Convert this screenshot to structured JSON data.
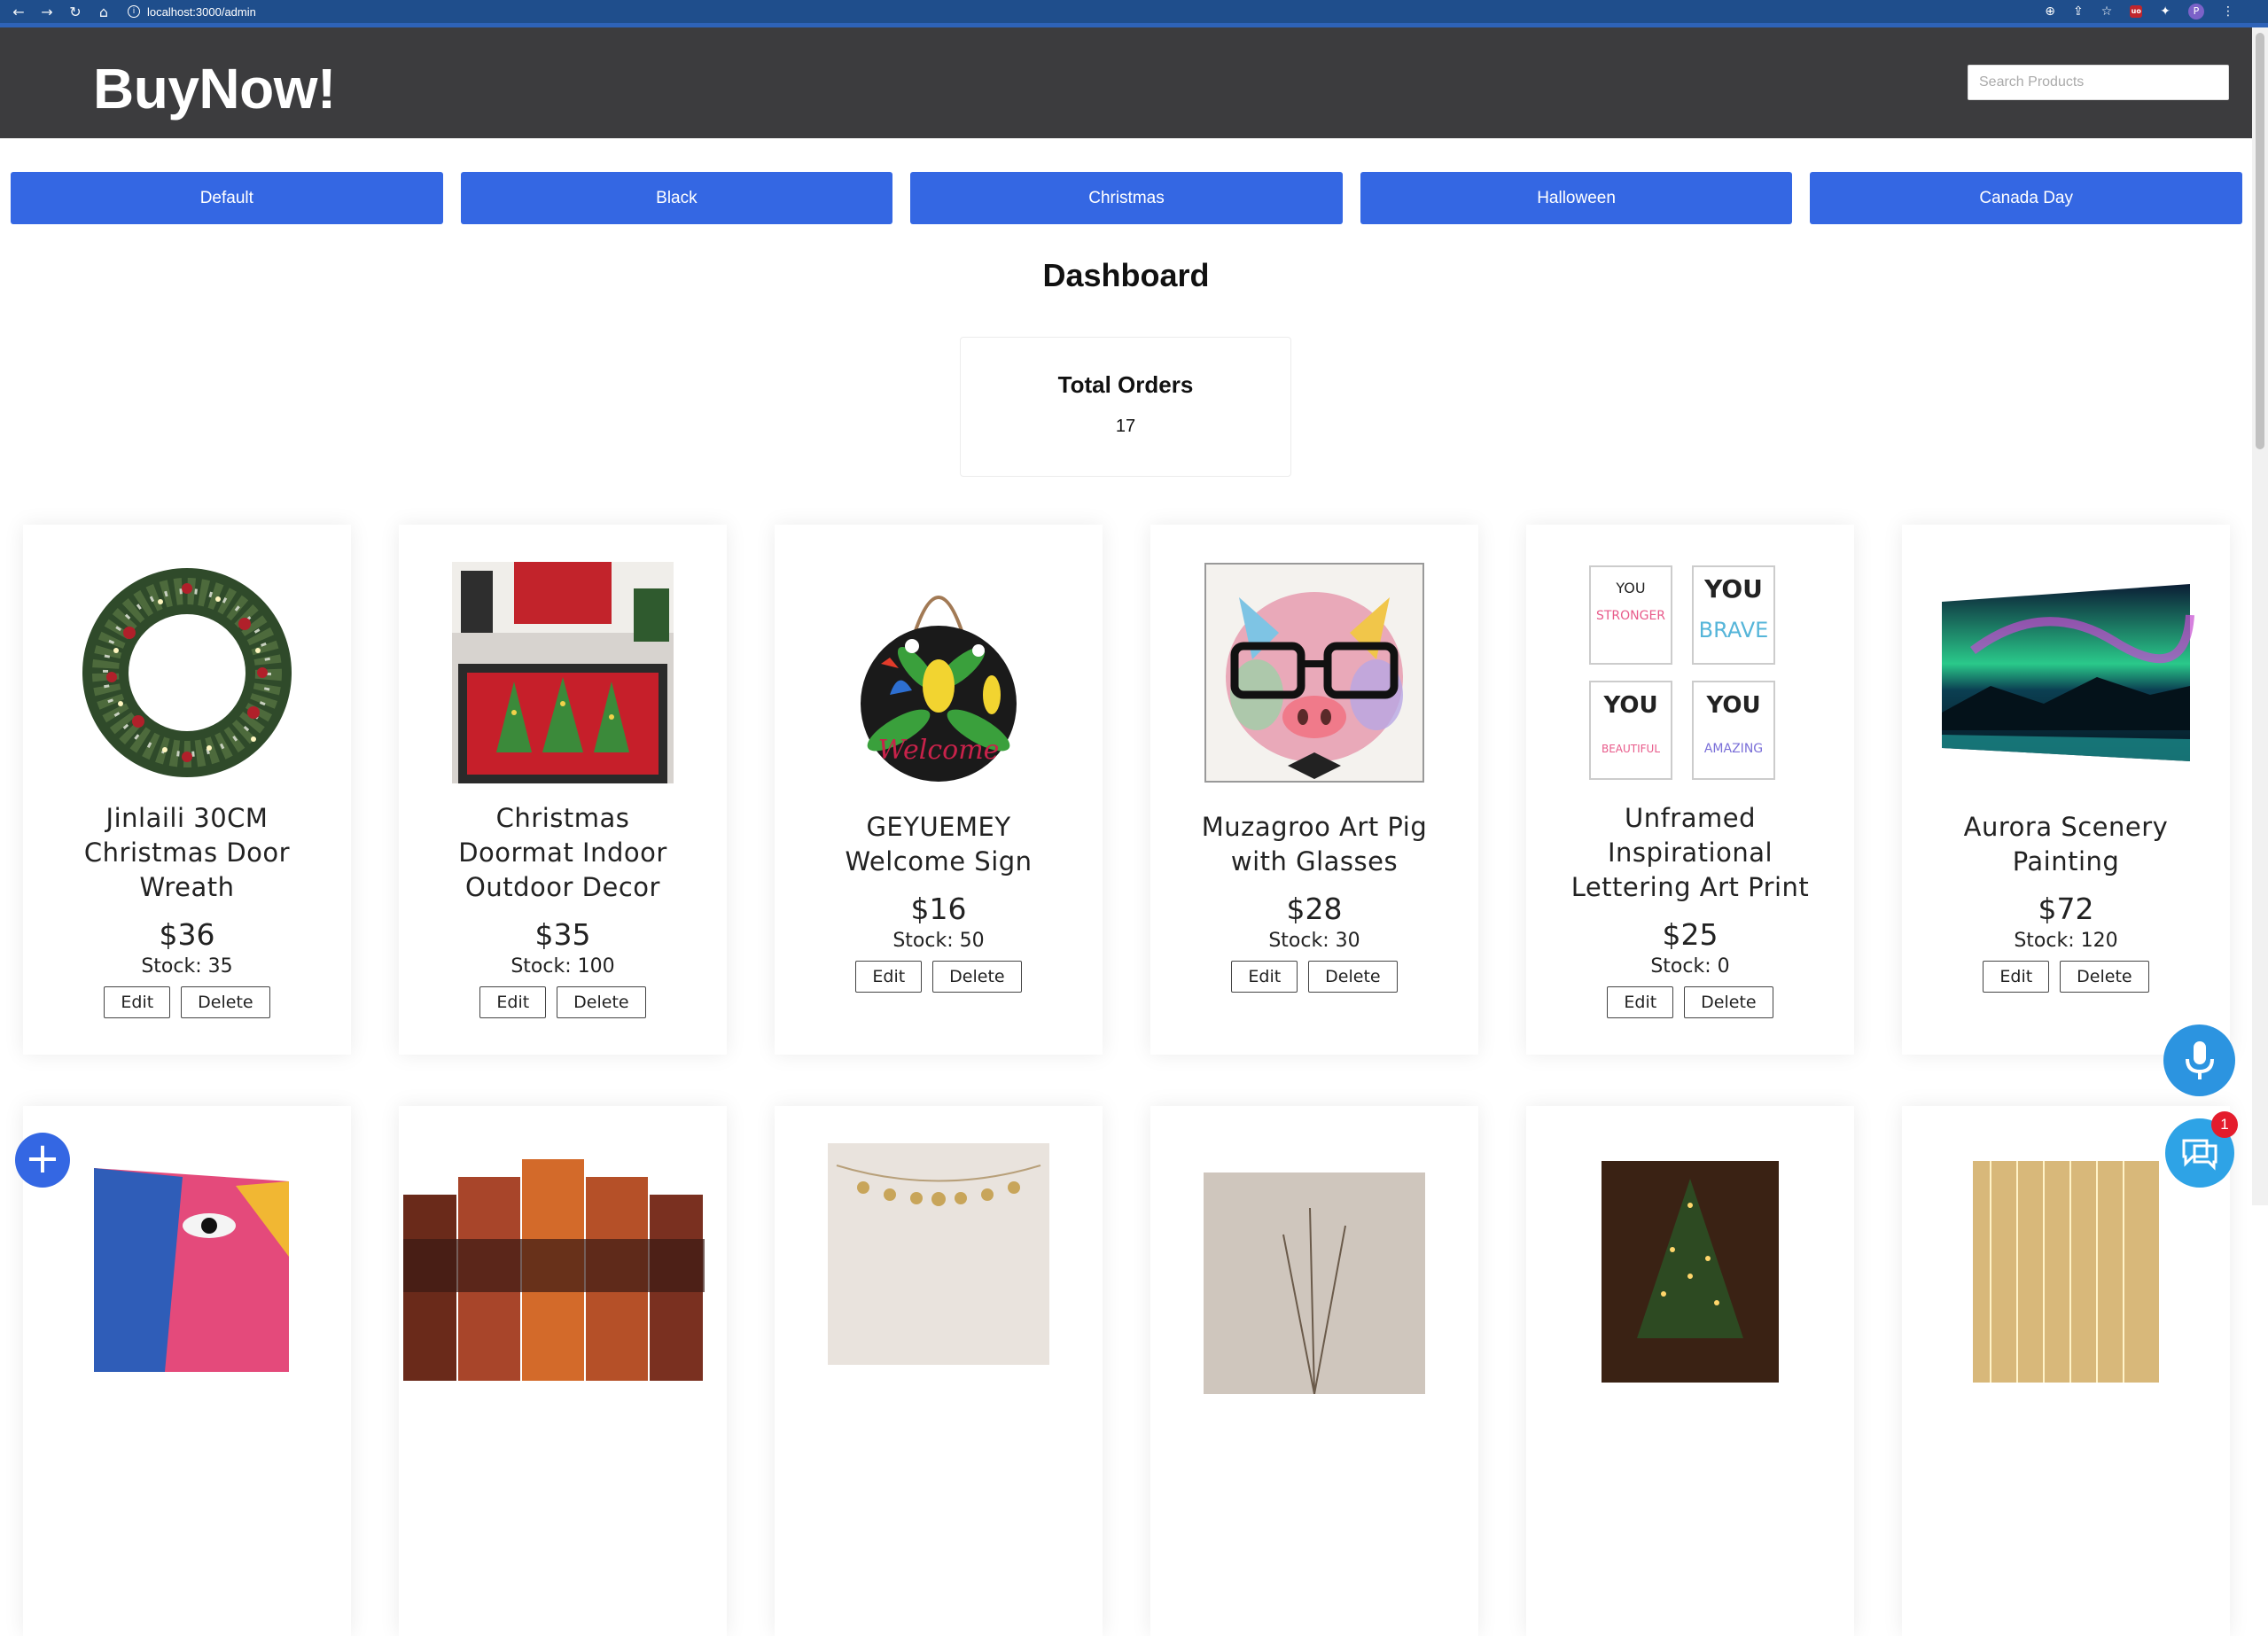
{
  "browser": {
    "url": "localhost:3000/admin",
    "profile_initial": "P",
    "extension_label": "uo"
  },
  "header": {
    "logo": "BuyNow!",
    "search_placeholder": "Search Products"
  },
  "themes": [
    "Default",
    "Black",
    "Christmas",
    "Halloween",
    "Canada Day"
  ],
  "dashboard": {
    "title": "Dashboard",
    "total_orders_label": "Total Orders",
    "total_orders_value": "17"
  },
  "products": [
    {
      "name": "Jinlaili 30CM Christmas Door Wreath",
      "price": "$36",
      "stock": "Stock: 35",
      "edit": "Edit",
      "delete": "Delete",
      "image": "wreath"
    },
    {
      "name": "Christmas Doormat Indoor Outdoor Decor",
      "price": "$35",
      "stock": "Stock: 100",
      "edit": "Edit",
      "delete": "Delete",
      "image": "doormat"
    },
    {
      "name": "GEYUEMEY Welcome Sign",
      "price": "$16",
      "stock": "Stock: 50",
      "edit": "Edit",
      "delete": "Delete",
      "image": "welcome-sign",
      "sign_text": "Welcome"
    },
    {
      "name": "Muzagroo Art Pig with Glasses",
      "price": "$28",
      "stock": "Stock: 30",
      "edit": "Edit",
      "delete": "Delete",
      "image": "pig-painting"
    },
    {
      "name": "Unframed Inspirational Lettering Art Print",
      "price": "$25",
      "stock": "Stock: 0",
      "edit": "Edit",
      "delete": "Delete",
      "image": "lettering-prints",
      "print_words": [
        "STRONGER",
        "BRAVE",
        "BEAUTIFUL",
        "AMAZING"
      ]
    },
    {
      "name": "Aurora Scenery Painting",
      "price": "$72",
      "stock": "Stock: 120",
      "edit": "Edit",
      "delete": "Delete",
      "image": "aurora-painting"
    }
  ],
  "floating": {
    "add_label": "+",
    "chat_badge": "1"
  }
}
